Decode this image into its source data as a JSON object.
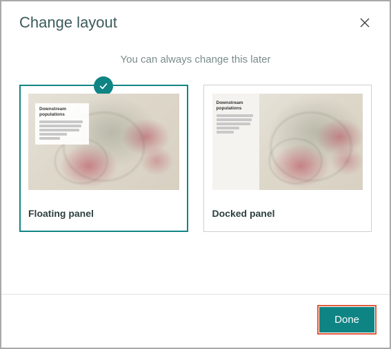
{
  "dialog": {
    "title": "Change layout",
    "subtitle": "You can always change this later",
    "options": [
      {
        "label": "Floating panel",
        "selected": true,
        "thumb_caption": "Downstream populations"
      },
      {
        "label": "Docked panel",
        "selected": false,
        "thumb_caption": "Downstream populations"
      }
    ],
    "done_label": "Done"
  },
  "colors": {
    "accent": "#0f8484",
    "highlight": "#e0593a"
  }
}
